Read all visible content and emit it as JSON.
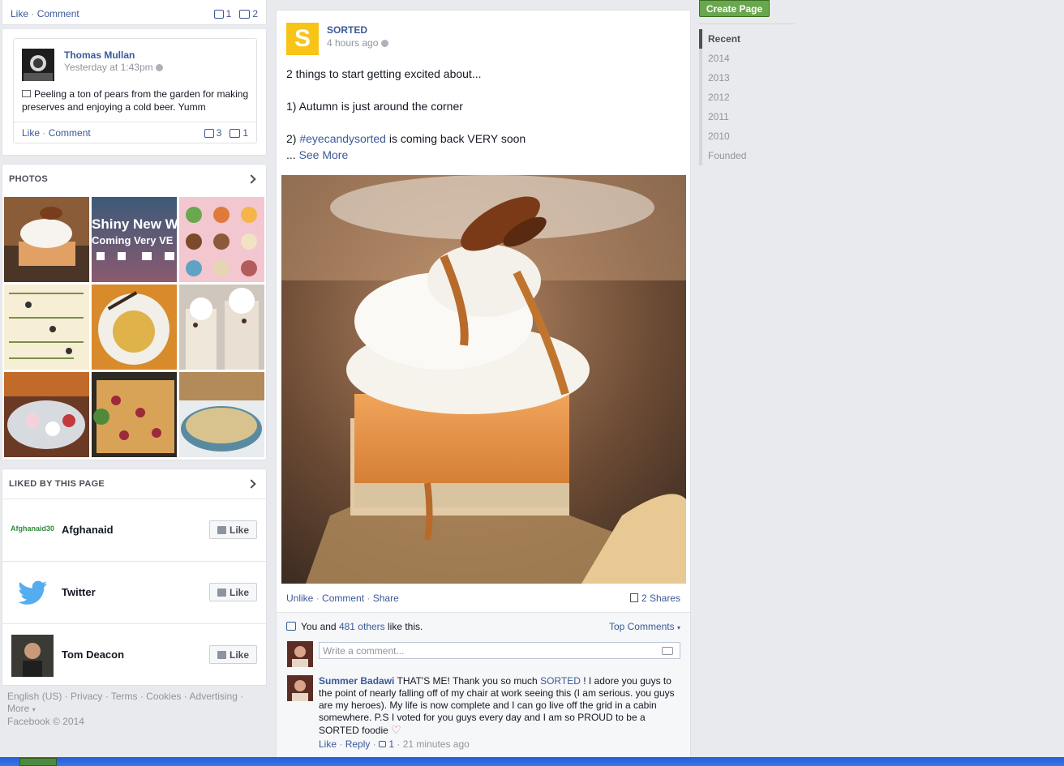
{
  "top_post": {
    "like": "Like",
    "comment": "Comment",
    "like_count": "1",
    "comment_count": "2"
  },
  "thomas_post": {
    "author": "Thomas Mullan",
    "time": "Yesterday at 1:43pm",
    "text": "Peeling a ton of pears from the garden for making preserves and enjoying a cold beer. Yumm",
    "like": "Like",
    "comment": "Comment",
    "like_count": "3",
    "comment_count": "1"
  },
  "photos": {
    "title": "PHOTOS",
    "tile2_text_line1": "Shiny New W",
    "tile2_text_line2": "Coming Very VE"
  },
  "liked": {
    "title": "LIKED BY THIS PAGE",
    "items": [
      {
        "name": "Afghanaid",
        "logo_text": "Afghanaid30",
        "button": "Like"
      },
      {
        "name": "Twitter",
        "button": "Like"
      },
      {
        "name": "Tom Deacon",
        "button": "Like"
      }
    ]
  },
  "footer": {
    "english": "English (US)",
    "privacy": "Privacy",
    "terms": "Terms",
    "cookies": "Cookies",
    "advertising": "Advertising",
    "more": "More",
    "copyright": "Facebook © 2014"
  },
  "main_post": {
    "page_name": "SORTED",
    "avatar_letter": "S",
    "time": "4 hours ago",
    "line1": "2 things to start getting excited about...",
    "line2": "1) Autumn is just around the corner",
    "line3_prefix": "2) ",
    "hashtag": "#eyecandysorted",
    "line3_suffix": " is coming back VERY soon",
    "see_more_prefix": "... ",
    "see_more": "See More",
    "unlike": "Unlike",
    "comment": "Comment",
    "share": "Share",
    "shares": "2 Shares",
    "likes_prefix": "You and ",
    "likes_others": "481 others",
    "likes_suffix": " like this.",
    "top_comments": "Top Comments",
    "comment_placeholder": "Write a comment...",
    "commenter": "Summer Badawi",
    "comment_text_a": " THAT'S ME! Thank you so much ",
    "comment_mention": "SORTED",
    "comment_text_b": " ! I adore you guys to the point of nearly falling off of my chair at work seeing this (I am serious. you guys are my heroes). My life is now complete and I can go live off the grid in a cabin somewhere. P.S I voted for you guys every day and I am so PROUD to be a SORTED foodie",
    "comment_like": "Like",
    "comment_reply": "Reply",
    "comment_like_count": "1",
    "comment_time": "21 minutes ago"
  },
  "sidebar": {
    "create_page": "Create Page",
    "timeline": [
      "Recent",
      "2014",
      "2013",
      "2012",
      "2011",
      "2010",
      "Founded"
    ]
  }
}
